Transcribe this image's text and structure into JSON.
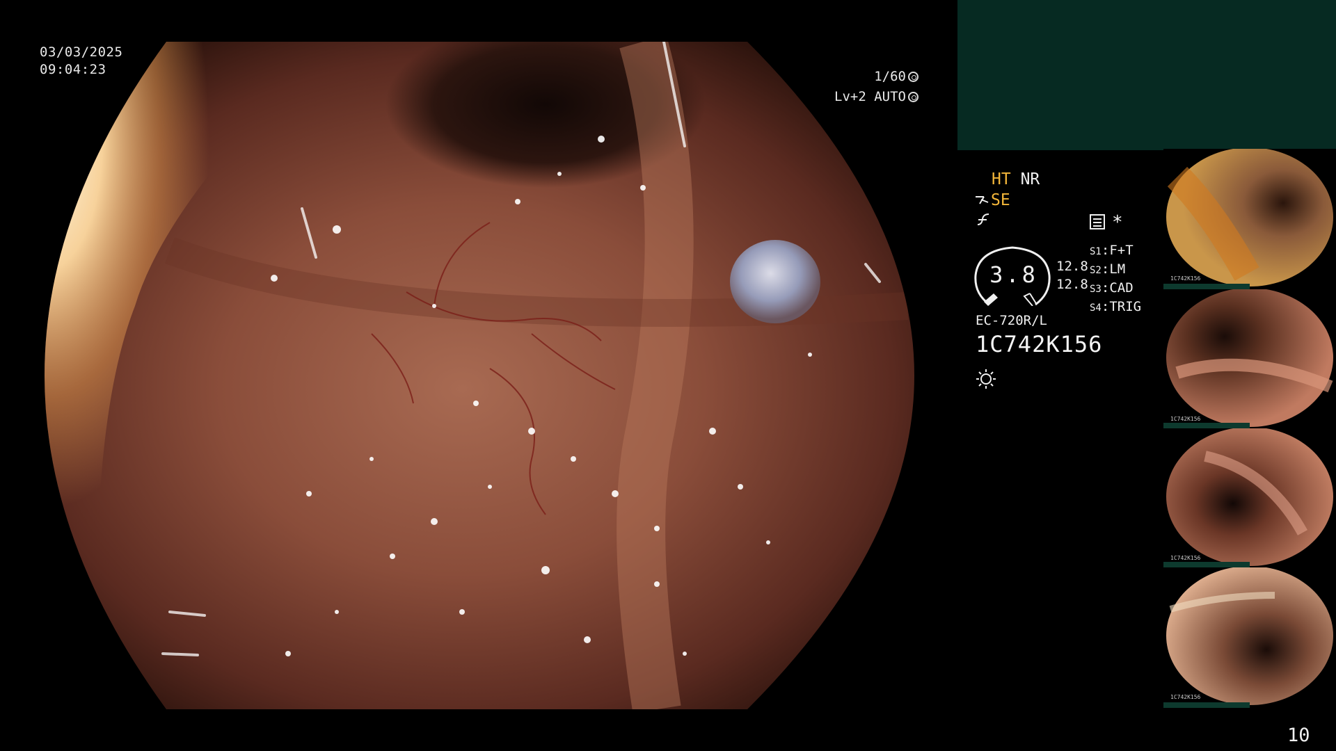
{
  "overlay": {
    "date": "03/03/2025",
    "time": "09:04:23",
    "shutter": "1/60",
    "level": "Lv+2 AUTO"
  },
  "panel": {
    "ht": "HT",
    "nr": "NR",
    "se": "SE",
    "gauge_value": "3.8",
    "side_value_1": "12.8",
    "side_value_2": "12.8",
    "s1_key": "S1",
    "s1_val": "F+T",
    "s2_key": "S2",
    "s2_val": "LM",
    "s3_key": "S3",
    "s3_val": "CAD",
    "s4_key": "S4",
    "s4_val": "TRIG",
    "model": "EC-720R/L",
    "serial": "1C742K156",
    "asterisk": "*"
  },
  "thumbnails": [
    {
      "label": "1C742K156"
    },
    {
      "label": "1C742K156"
    },
    {
      "label": "1C742K156"
    },
    {
      "label": "1C742K156"
    }
  ],
  "counter": "10",
  "icons": [
    "aperture-icon",
    "auto-exposure-icon",
    "structure-enhance-icon",
    "color-enhance-icon",
    "record-icon",
    "light-source-icon"
  ],
  "colors": {
    "accent_yellow": "#f4b73a",
    "panel_teal": "#062a22"
  }
}
